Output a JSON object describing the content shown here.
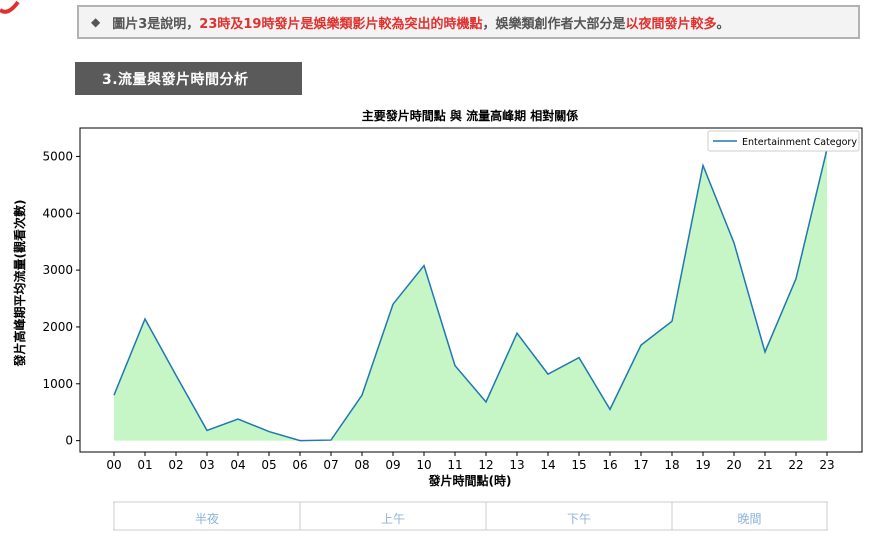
{
  "note": {
    "bullet": "◆",
    "part1": "圖片3是說明，",
    "highlight1": "23時及19時發片是娛樂類影片較為突出的時機點",
    "part2": "，娛樂類創作者大部分是",
    "highlight2": "以夜間發片較多",
    "part3": "。"
  },
  "section": {
    "title": "3.流量與發片時間分析"
  },
  "colors": {
    "line": "#1f77b4",
    "fill": "#c6f5c6",
    "note_highlight": "#e0312f",
    "period_text": "#8fb3dc"
  },
  "chart_data": {
    "type": "area",
    "title": "主要發片時間點 與 流量高峰期 相對關係",
    "xlabel": "發片時間點(時)",
    "ylabel": "發片高峰期平均流量(觀看次數)",
    "x": [
      "00",
      "01",
      "02",
      "03",
      "04",
      "05",
      "06",
      "07",
      "08",
      "09",
      "10",
      "11",
      "12",
      "13",
      "14",
      "15",
      "16",
      "17",
      "18",
      "19",
      "20",
      "21",
      "22",
      "23"
    ],
    "series": [
      {
        "name": "Entertainment Category",
        "values": [
          800,
          2140,
          1150,
          180,
          380,
          160,
          0,
          10,
          800,
          2400,
          3080,
          1320,
          680,
          1890,
          1170,
          1460,
          550,
          1680,
          2100,
          4840,
          3480,
          1560,
          2850,
          5130
        ]
      }
    ],
    "ylim": [
      -200,
      5500
    ],
    "yticks": [
      0,
      1000,
      2000,
      3000,
      4000,
      5000
    ],
    "legend": "top-right",
    "grid": false,
    "periods": [
      {
        "label": "半夜",
        "start": "00",
        "end": "06"
      },
      {
        "label": "上午",
        "start": "06",
        "end": "12"
      },
      {
        "label": "下午",
        "start": "12",
        "end": "18"
      },
      {
        "label": "晚間",
        "start": "18",
        "end": "23"
      }
    ]
  }
}
